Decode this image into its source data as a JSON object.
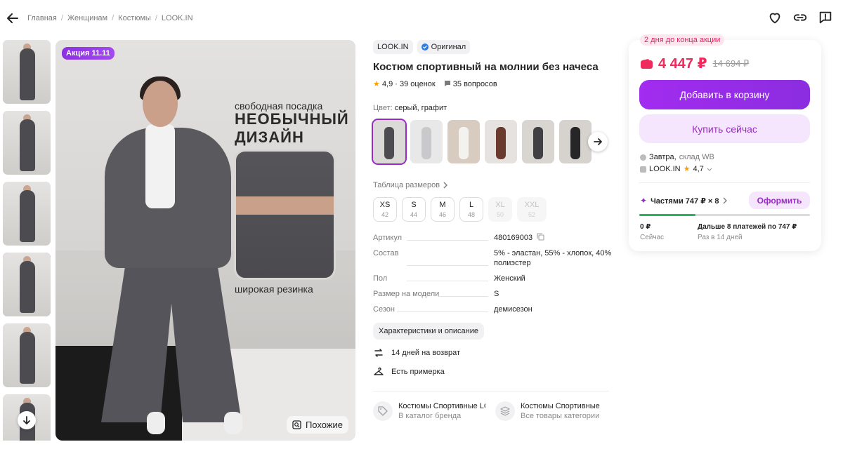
{
  "breadcrumbs": [
    "Главная",
    "Женщинам",
    "Костюмы",
    "LOOK.IN"
  ],
  "top_actions": [
    "heart-icon",
    "link-icon",
    "report-icon"
  ],
  "gallery": {
    "promo_badge": "Акция 11.11",
    "overlay_line1": "свободная посадка",
    "overlay_line2": "НЕОБЫЧНЫЙ ДИЗАЙН",
    "overlay_line3": "широкая резинка",
    "similar_button": "Похожие"
  },
  "product": {
    "brand": "LOOK.IN",
    "original_label": "Оригинал",
    "title": "Костюм спортивный на молнии без начеса",
    "rating": "4,9",
    "reviews": "39 оценок",
    "questions": "35 вопросов",
    "color_label": "Цвет:",
    "color_value": "серый, графит",
    "size_table_label": "Таблица размеров",
    "sizes": [
      {
        "label": "XS",
        "ru": "42",
        "available": true
      },
      {
        "label": "S",
        "ru": "44",
        "available": true
      },
      {
        "label": "M",
        "ru": "46",
        "available": true
      },
      {
        "label": "L",
        "ru": "48",
        "available": true
      },
      {
        "label": "XL",
        "ru": "50",
        "available": false
      },
      {
        "label": "XXL",
        "ru": "52",
        "available": false
      }
    ],
    "specs": [
      {
        "key": "Артикул",
        "value": "480169003"
      },
      {
        "key": "Состав",
        "value": "5% - эластан, 55% - хлопок, 40% полиэстер"
      },
      {
        "key": "Пол",
        "value": "Женский"
      },
      {
        "key": "Размер на модели",
        "value": "S"
      },
      {
        "key": "Сезон",
        "value": "демисезон"
      }
    ],
    "characteristics_button": "Характеристики и описание",
    "features": [
      "14 дней на возврат",
      "Есть примерка"
    ],
    "links": [
      {
        "title": "Костюмы Спортивные LOOK.IN",
        "subtitle": "В каталог бренда"
      },
      {
        "title": "Костюмы Спортивные",
        "subtitle": "Все товары категории"
      }
    ]
  },
  "buy": {
    "deadline": "2 дня до конца акции",
    "price": "4 447 ₽",
    "old_price": "14 694 ₽",
    "add_to_cart": "Добавить в корзину",
    "buy_now": "Купить сейчас",
    "delivery_day": "Завтра,",
    "delivery_place": "склад WB",
    "seller": "LOOK.IN",
    "seller_rating": "4,7",
    "installments_label": "Частями 747 ₽ × 8",
    "arrange_button": "Оформить",
    "progress_fraction": 0.33,
    "today_amount": "0 ₽",
    "today_label": "Сейчас",
    "rest_text": "Дальше 8 платежей по 747 ₽",
    "rest_period": "Раз в 14 дней"
  },
  "colors": {
    "accent": "#9a2ac6",
    "price_red": "#ef2a5d",
    "progress_green": "#29b35f"
  }
}
